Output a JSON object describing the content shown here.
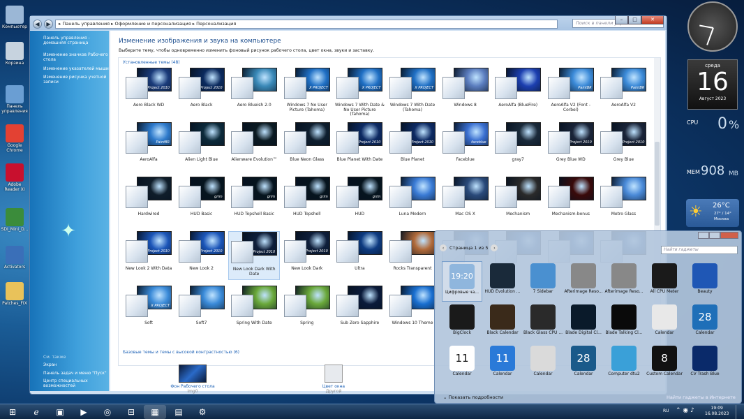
{
  "desktop_icons": [
    {
      "label": "Компьютер",
      "color": "#9bb7d6"
    },
    {
      "label": "Корзина",
      "color": "#c7d3df"
    },
    {
      "label": "Панель управления",
      "color": "#6a9ed3"
    },
    {
      "label": "Google Chrome",
      "color": "#e34133"
    },
    {
      "label": "Adobe Reader XI",
      "color": "#c8102e"
    },
    {
      "label": "SDI_Mini_D...",
      "color": "#3b8c3b"
    },
    {
      "label": "Activators",
      "color": "#3a6fb8"
    },
    {
      "label": "Patches_FIX",
      "color": "#e9c25a"
    }
  ],
  "window": {
    "breadcrumb": "▸ Панель управления ▸ Оформление и персонализация ▸ Персонализация",
    "search_placeholder": "Поиск в панели управления",
    "min": "–",
    "max": "□",
    "close": "✕",
    "back": "◀",
    "fwd": "▶"
  },
  "left_nav": {
    "links": [
      "Панель управления - домашняя страница",
      "Изменение значков Рабочего стола",
      "Изменение указателей мыши",
      "Изменение рисунка учетной записи"
    ],
    "see_also": "См. также",
    "bottom": [
      "Экран",
      "Панель задач и меню \"Пуск\"",
      "Центр специальных возможностей"
    ]
  },
  "main": {
    "title": "Изменение изображения и звука на компьютере",
    "desc": "Выберите тему, чтобы одновременно изменить фоновый рисунок рабочего стола, цвет окна, звуки и заставку.",
    "installed_header": "Установленные темы (48)",
    "basic_header": "Базовые темы и темы с высокой контрастностью (6)",
    "themes": [
      {
        "name": "Aero Black WD",
        "c": "#1a3b7a",
        "tag": "X Project 2010"
      },
      {
        "name": "Aero Black",
        "c": "#0b2a5e",
        "tag": "X Project 2010"
      },
      {
        "name": "Aero Blueish 2.0",
        "c": "#3a89b8",
        "tag": ""
      },
      {
        "name": "Windows 7 No User Picture (Tahoma)",
        "c": "#1f6fc4",
        "tag": "X PROJECT"
      },
      {
        "name": "Windows 7 With Date & No User Picture (Tahoma)",
        "c": "#1f6fc4",
        "tag": "X PROJECT"
      },
      {
        "name": "Windows 7 With Date (Tahoma)",
        "c": "#1f6fc4",
        "tag": "X PROJECT"
      },
      {
        "name": "Windows 8",
        "c": "#5b7dbf",
        "tag": ""
      },
      {
        "name": "AeroAlfa (BlueFire)",
        "c": "#1c3fb0",
        "tag": ""
      },
      {
        "name": "AeroAlfa V2 (Font - Corbel)",
        "c": "#3b8ad8",
        "tag": "PaintBR"
      },
      {
        "name": "AeroAlfa V2",
        "c": "#3b8ad8",
        "tag": "PaintBR"
      },
      {
        "name": "AeroAlfa",
        "c": "#2e7acb",
        "tag": "PaintBR"
      },
      {
        "name": "Alien Light Blue",
        "c": "#0c2a3a",
        "tag": ""
      },
      {
        "name": "Alienware Evolution™",
        "c": "#0b1a22",
        "tag": ""
      },
      {
        "name": "Blue Neon Glass",
        "c": "#0e1e2e",
        "tag": ""
      },
      {
        "name": "Blue Planet With Date",
        "c": "#0d2a63",
        "tag": "X Project 2010"
      },
      {
        "name": "Blue Planet",
        "c": "#0d2a63",
        "tag": "X Project 2010"
      },
      {
        "name": "Faceblue",
        "c": "#3a6fd0",
        "tag": "faceblue"
      },
      {
        "name": "gray7",
        "c": "#1a2a3a",
        "tag": ""
      },
      {
        "name": "Grey Blue WD",
        "c": "#1a2438",
        "tag": "X Project 2010"
      },
      {
        "name": "Grey Blue",
        "c": "#1a2438",
        "tag": "X Project 2010"
      },
      {
        "name": "Hardwired",
        "c": "#0f1d2a",
        "tag": ""
      },
      {
        "name": "HUD Basic",
        "c": "#06141e",
        "tag": "grim"
      },
      {
        "name": "HUD Topshell Basic",
        "c": "#06141e",
        "tag": "grim"
      },
      {
        "name": "HUD Topshell",
        "c": "#06141e",
        "tag": "grim"
      },
      {
        "name": "HUD",
        "c": "#06141e",
        "tag": "grim"
      },
      {
        "name": "Luna Modern",
        "c": "#3a7bd5",
        "tag": ""
      },
      {
        "name": "Mac OS X",
        "c": "#2a4a7a",
        "tag": ""
      },
      {
        "name": "Mechanism",
        "c": "#2a2a2a",
        "tag": ""
      },
      {
        "name": "Mechanism-bonus",
        "c": "#3a0a0a",
        "tag": ""
      },
      {
        "name": "Metro Glass",
        "c": "#4a8ad8",
        "tag": ""
      },
      {
        "name": "New Look 2 With Data",
        "c": "#1b55b8",
        "tag": "X Project 2010"
      },
      {
        "name": "New Look 2",
        "c": "#1b55b8",
        "tag": "X Project 2010"
      },
      {
        "name": "New Look Dark With Date",
        "c": "#0e1e3a",
        "tag": "X Project 2010"
      },
      {
        "name": "New Look Dark",
        "c": "#0e1e3a",
        "tag": "X Project 2010"
      },
      {
        "name": "Ultra",
        "c": "#0d3a80",
        "tag": ""
      },
      {
        "name": "Rocks Transparent",
        "c": "#b06a3a",
        "tag": ""
      },
      {
        "name": "",
        "c": "#2a5a9a",
        "tag": ""
      },
      {
        "name": "",
        "c": "#2a5a9a",
        "tag": ""
      },
      {
        "name": "",
        "c": "#2a5a9a",
        "tag": ""
      },
      {
        "name": "",
        "c": "#2a5a9a",
        "tag": ""
      },
      {
        "name": "Soft",
        "c": "#3a8ad8",
        "tag": "X PROJECT"
      },
      {
        "name": "Soft7",
        "c": "#3a8ad8",
        "tag": ""
      },
      {
        "name": "Spring With Date",
        "c": "#6aa83a",
        "tag": ""
      },
      {
        "name": "Spring",
        "c": "#6aa83a",
        "tag": ""
      },
      {
        "name": "Sub Zero Sapphire",
        "c": "#0a1a3a",
        "tag": ""
      },
      {
        "name": "Windows 10 Theme",
        "c": "#1a6fd0",
        "tag": ""
      }
    ],
    "footer": {
      "wallpaper_label": "Фон Рабочего стола",
      "wallpaper_sub": "img0",
      "color_label": "Цвет окна",
      "color_sub": "Другой"
    }
  },
  "gadgets": {
    "page": "Страница 1 из 5",
    "search_placeholder": "Найти гаджеты",
    "details": "Показать подробности",
    "online": "Найти гаджеты в Интернете",
    "items": [
      {
        "name": "Цифровые ча...",
        "c": "#8fb6dd"
      },
      {
        "name": "HUD Evolution ...",
        "c": "#1a2a3a"
      },
      {
        "name": "7 Sidebar",
        "c": "#4a90d0"
      },
      {
        "name": "Afterimage Reso...",
        "c": "#888"
      },
      {
        "name": "Afterimage Reso...",
        "c": "#888"
      },
      {
        "name": "All CPU Meter",
        "c": "#1a1a1a"
      },
      {
        "name": "Beauty",
        "c": "#1f57b5"
      },
      {
        "name": "BigClock",
        "c": "#1a1a1a"
      },
      {
        "name": "Black Calendar",
        "c": "#3a2a1a"
      },
      {
        "name": "Black Glass CPU ...",
        "c": "#2a2a2a"
      },
      {
        "name": "Blade Digital Cl...",
        "c": "#0a1a2a"
      },
      {
        "name": "Blade Talking Cl...",
        "c": "#0a0a0a"
      },
      {
        "name": "Calendar",
        "c": "#e8e8e8"
      },
      {
        "name": "Calendar",
        "c": "#1f6fb8"
      },
      {
        "name": "Calendar",
        "c": "#ffffff"
      },
      {
        "name": "Calendar",
        "c": "#2a7ad8"
      },
      {
        "name": "Calendar",
        "c": "#dadada"
      },
      {
        "name": "Calendar",
        "c": "#1a5a8a"
      },
      {
        "name": "Computer dtu2",
        "c": "#3aa0d8"
      },
      {
        "name": "Custom Calendar",
        "c": "#111"
      },
      {
        "name": "CV Trash Blue",
        "c": "#0a2a6a"
      }
    ],
    "nums": [
      "19:20",
      "",
      "",
      "",
      "",
      "",
      "",
      "",
      "",
      "",
      "",
      "",
      "",
      "28",
      "11",
      "11",
      "",
      "28",
      "",
      "8",
      ""
    ]
  },
  "side": {
    "day": "среда",
    "date": "16",
    "month": "Август 2023",
    "cpu_label": "CPU",
    "cpu": "0",
    "cpu_unit": "%",
    "mem_label": "MEM",
    "mem": "908",
    "mem_unit": "MB",
    "temp": "26°C",
    "temp_range": "27° / 14°",
    "city": "Москва"
  },
  "taskbar": {
    "lang": "RU",
    "time": "19:09",
    "date": "16.08.2023"
  }
}
